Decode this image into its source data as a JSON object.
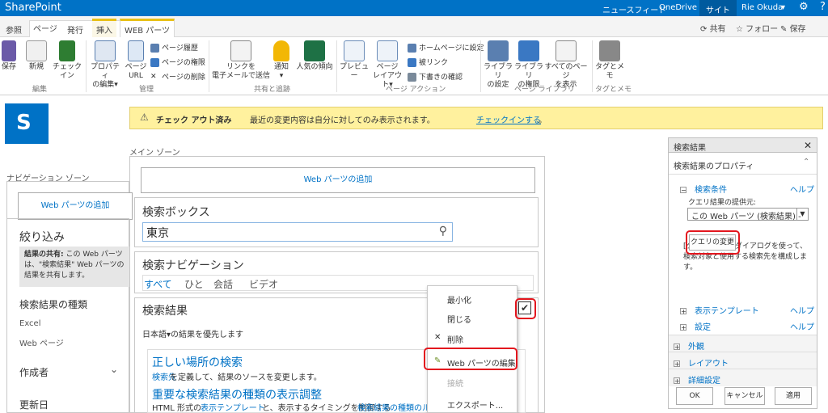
{
  "topbar": {
    "brand": "SharePoint",
    "links": [
      "ニュースフィード",
      "OneDrive",
      "サイト"
    ],
    "user": "Rie Okuda",
    "user_caret": "▾",
    "gear": "⚙",
    "help": "?",
    "accent": "#0072c6"
  },
  "tabs": [
    "参照",
    "ページ",
    "発行",
    "挿入",
    "WEB パーツ"
  ],
  "right_actions": {
    "share": "共有",
    "follow": "フォロー",
    "save": "保存"
  },
  "ribbon": {
    "buttons": {
      "save": "保存",
      "new": "新規",
      "checkin": "チェックイン",
      "props": "プロパティ\nの編集▾",
      "page_url": "ページ\nURL",
      "send_link": "リンクを\n電子メールで送信",
      "alert": "通知\n▾",
      "popularity": "人気の傾向",
      "preview": "プレビュー",
      "page_layout": "ページ\nレイアウト▾",
      "lib_settings": "ライブラリ\nの設定",
      "lib_perms": "ライブラリ\nの権限",
      "all_pages": "すべてのページ\nを表示",
      "tags": "タグとメモ"
    },
    "small": {
      "history": "ページ履歴",
      "perms": "ページの権限",
      "delete": "ページの削除",
      "homepage": "ホームページに設定",
      "incoming": "被リンク",
      "drafts": "下書きの確認"
    },
    "groups": {
      "edit": "編集",
      "manage": "管理",
      "share": "共有と追跡",
      "page_actions": "ページ アクション",
      "page_library": "ページ ライブラリ",
      "tags": "タグとメモ"
    }
  },
  "notice": {
    "icon": "⚠",
    "bold": "チェック アウト済み",
    "text": "最近の変更内容は自分に対してのみ表示されます。",
    "link": "チェックインする",
    "end": "。"
  },
  "zones": {
    "main": "メイン ゾーン",
    "nav": "ナビゲーション ゾーン",
    "add_wp": "Web パーツの追加"
  },
  "refine": {
    "title": "絞り込み",
    "info_bold": "結果の共有:",
    "info": "この Web パーツは、\"検索結果\" Web パーツの結果を共有します。",
    "facets": [
      "検索結果の種類",
      "Excel",
      "Web ページ",
      "作成者",
      "更新日"
    ],
    "chev": "⌄"
  },
  "searchbox": {
    "title": "検索ボックス",
    "query": "東京",
    "icon": "⚲"
  },
  "searchnav": {
    "title": "検索ナビゲーション",
    "items": [
      "すべて",
      "ひと",
      "会話",
      "ビデオ"
    ]
  },
  "results": {
    "title": "検索結果",
    "lang": "日本語▾の結果を優先します",
    "r1_title": "正しい場所の検索",
    "r1_link": "検索先",
    "r1_text": "を定義して、結果のソースを変更します。",
    "r2_title": "重要な検索結果の種類の表示調整",
    "r2_a": "HTML 形式の",
    "r2_link": "表示テンプレート",
    "r2_b": "と、表示するタイミングを制御する",
    "r2_link2": "検索結果の種類のル"
  },
  "menu": {
    "items": [
      "最小化",
      "閉じる",
      "削除",
      "Web パーツの編集",
      "接続",
      "エクスポート..."
    ],
    "delete_icon": "✕",
    "edit_icon": "✎",
    "check": "✔"
  },
  "tool": {
    "header": "検索結果",
    "close": "✕",
    "props": "検索結果のプロパティ",
    "criteria": "検索条件",
    "help": "ヘルプ",
    "provider_label": "クエリ結果の提供元:",
    "provider": "この Web パーツ (検索結果) -",
    "change_query": "クエリの変更",
    "desc": "[クエリの変更] ダイアログを使って、検索対象と使用する検索先を構成します。",
    "display_tpl": "表示テンプレート",
    "settings": "設定",
    "sections": [
      "外観",
      "レイアウト",
      "詳細設定"
    ],
    "ok": "OK",
    "cancel": "キャンセル",
    "apply": "適用",
    "collapse": "⌃"
  }
}
